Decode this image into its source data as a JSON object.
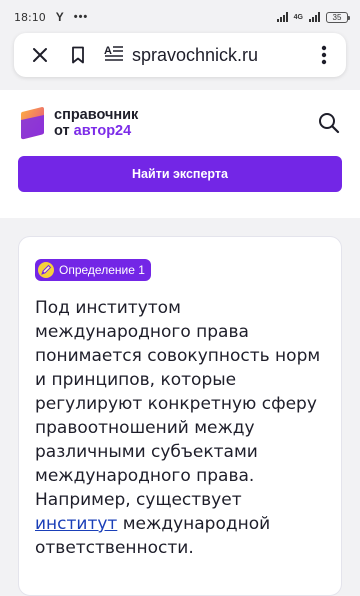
{
  "status_bar": {
    "time": "18:10",
    "carrier_icon_label": "Y",
    "dots": "•••",
    "network": "4G",
    "battery": "35"
  },
  "browser": {
    "url": "spravochnick.ru",
    "close_icon": "close-icon",
    "bookmark_icon": "bookmark-icon",
    "reader_icon": "reader-mode-icon",
    "menu_icon": "more-vertical-icon"
  },
  "site": {
    "logo_line1": "справочник",
    "logo_line2_prefix": "от ",
    "logo_line2_brand": "автор24",
    "search_icon": "search-icon",
    "expert_button_label": "Найти эксперта",
    "colors": {
      "accent": "#7326e6",
      "logo_orange": "#ff8a3d",
      "logo_pink": "#e0468e"
    }
  },
  "definition": {
    "badge_label": "Определение 1",
    "text_before_link": "Под институтом международного права понимается совокупность норм и принципов, которые регулируют конкретную сферу правоотношений между различными субъектами международного права. Например, существует ",
    "link_text": "институт",
    "text_after_link": " международной ответственности."
  }
}
